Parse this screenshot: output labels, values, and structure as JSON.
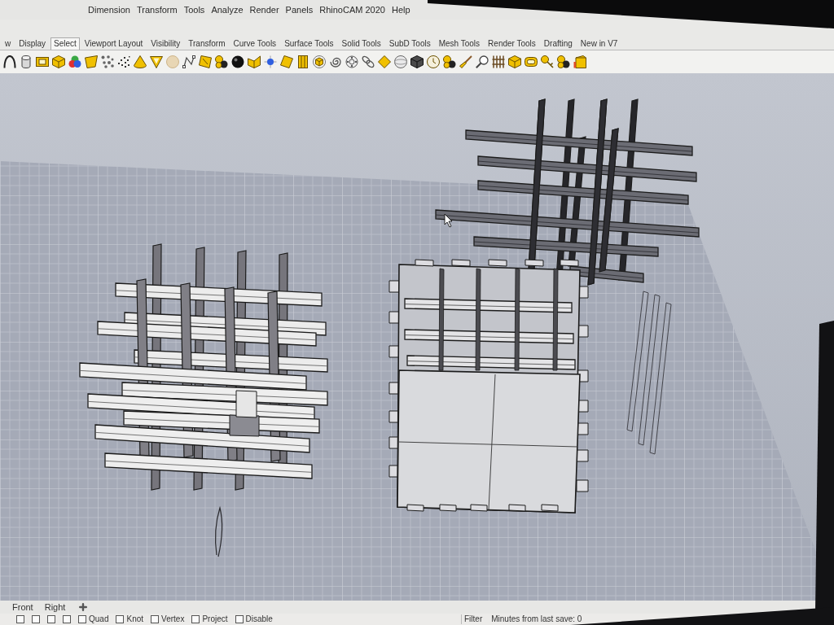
{
  "menu_bar": {
    "items": [
      "Dimension",
      "Transform",
      "Tools",
      "Analyze",
      "Render",
      "Panels",
      "RhinoCAM 2020",
      "Help"
    ]
  },
  "toolbar_tabs": [
    {
      "label": "w",
      "selected": false
    },
    {
      "label": "Display",
      "selected": false
    },
    {
      "label": "Select",
      "selected": true
    },
    {
      "label": "Viewport Layout",
      "selected": false
    },
    {
      "label": "Visibility",
      "selected": false
    },
    {
      "label": "Transform",
      "selected": false
    },
    {
      "label": "Curve Tools",
      "selected": false
    },
    {
      "label": "Surface Tools",
      "selected": false
    },
    {
      "label": "Solid Tools",
      "selected": false
    },
    {
      "label": "SubD Tools",
      "selected": false
    },
    {
      "label": "Mesh Tools",
      "selected": false
    },
    {
      "label": "Render Tools",
      "selected": false
    },
    {
      "label": "Drafting",
      "selected": false
    },
    {
      "label": "New in V7",
      "selected": false
    }
  ],
  "viewport_tabs": [
    {
      "label": "Front",
      "selected": false
    },
    {
      "label": "Right",
      "selected": false
    }
  ],
  "osnap": [
    {
      "checked": false
    },
    {
      "checked": false
    },
    {
      "checked": false
    },
    {
      "checked": false
    },
    {
      "label": "Quad",
      "checked": false
    },
    {
      "label": "Knot",
      "checked": false
    },
    {
      "label": "Vertex",
      "checked": false
    },
    {
      "label": "Project",
      "checked": false
    },
    {
      "label": "Disable",
      "checked": false
    }
  ],
  "status_bar": {
    "filter": "Filter",
    "save_info": "Minutes from last save: 0"
  }
}
